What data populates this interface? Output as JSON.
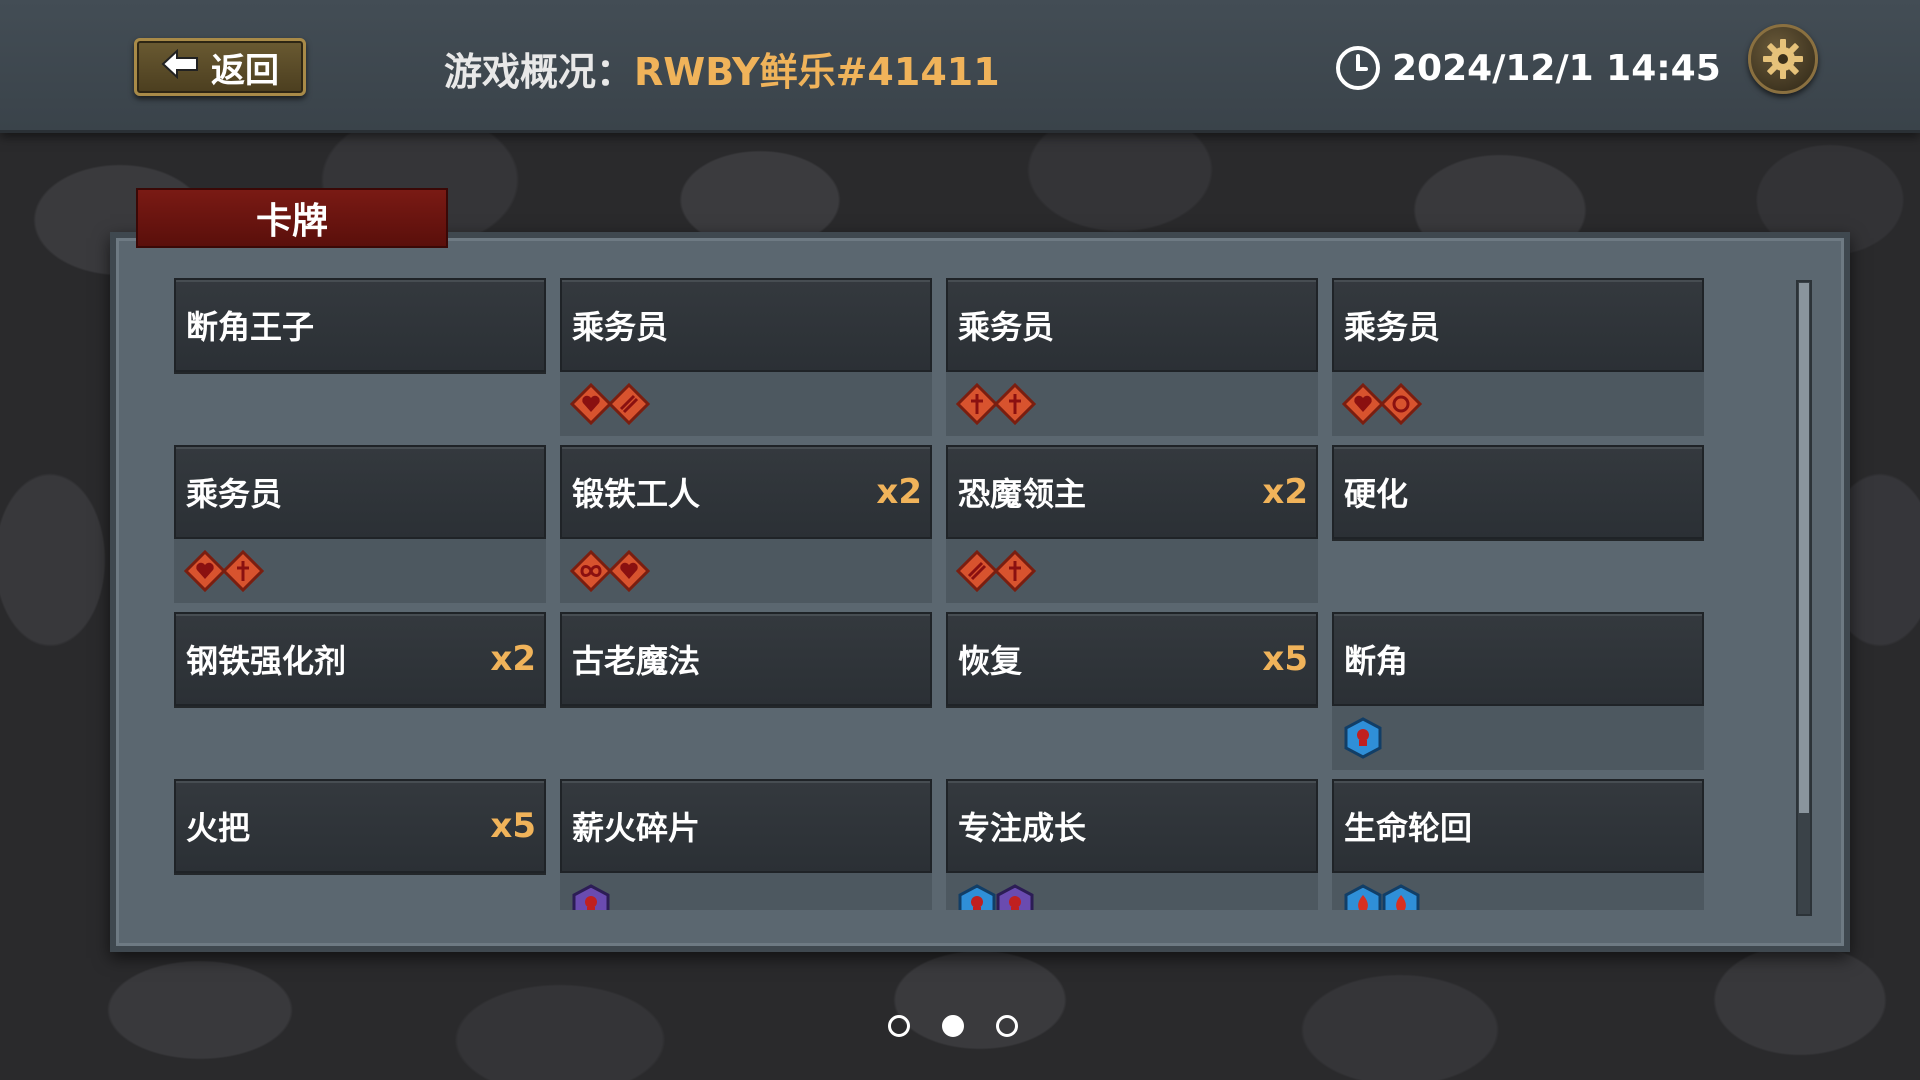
{
  "header": {
    "back_label": "返回",
    "title_label": "游戏概况：",
    "game_name": "RWBY鲜乐#41411",
    "datetime": "2024/12/1 14:45"
  },
  "section": {
    "tab_label": "卡牌"
  },
  "cards": [
    {
      "name": "断角王子",
      "count": "",
      "gems": []
    },
    {
      "name": "乘务员",
      "count": "",
      "gems": [
        "red-heart-gem",
        "red-stripes-gem"
      ]
    },
    {
      "name": "乘务员",
      "count": "",
      "gems": [
        "red-sword-gem",
        "red-sword-gem"
      ]
    },
    {
      "name": "乘务员",
      "count": "",
      "gems": [
        "red-heart-gem",
        "red-swirl-gem"
      ]
    },
    {
      "name": "乘务员",
      "count": "",
      "gems": [
        "red-heart-gem",
        "red-sword-gem"
      ]
    },
    {
      "name": "锻铁工人",
      "count": "x2",
      "gems": [
        "red-infinity-gem",
        "red-heart-gem"
      ]
    },
    {
      "name": "恐魔领主",
      "count": "x2",
      "gems": [
        "red-stripes-gem",
        "red-sword-gem"
      ]
    },
    {
      "name": "硬化",
      "count": "",
      "gems": []
    },
    {
      "name": "钢铁强化剂",
      "count": "x2",
      "gems": []
    },
    {
      "name": "古老魔法",
      "count": "",
      "gems": []
    },
    {
      "name": "恢复",
      "count": "x5",
      "gems": []
    },
    {
      "name": "断角",
      "count": "",
      "gems": [
        "blue-skull-gem"
      ]
    },
    {
      "name": "火把",
      "count": "x5",
      "gems": []
    },
    {
      "name": "薪火碎片",
      "count": "",
      "gems": [
        "purple-skull-gem"
      ]
    },
    {
      "name": "专注成长",
      "count": "",
      "gems": [
        "blue-skull-gem",
        "purple-skull-gem"
      ]
    },
    {
      "name": "生命轮回",
      "count": "",
      "gems": [
        "blue-fire-gem",
        "blue-fire-gem"
      ]
    }
  ],
  "pagination": {
    "pages": 3,
    "active_page": 2
  },
  "colors": {
    "accent_gold": "#f0b35a",
    "tab_red": "#6a130e",
    "panel": "#5b6770",
    "card_dark": "#2f3439"
  }
}
